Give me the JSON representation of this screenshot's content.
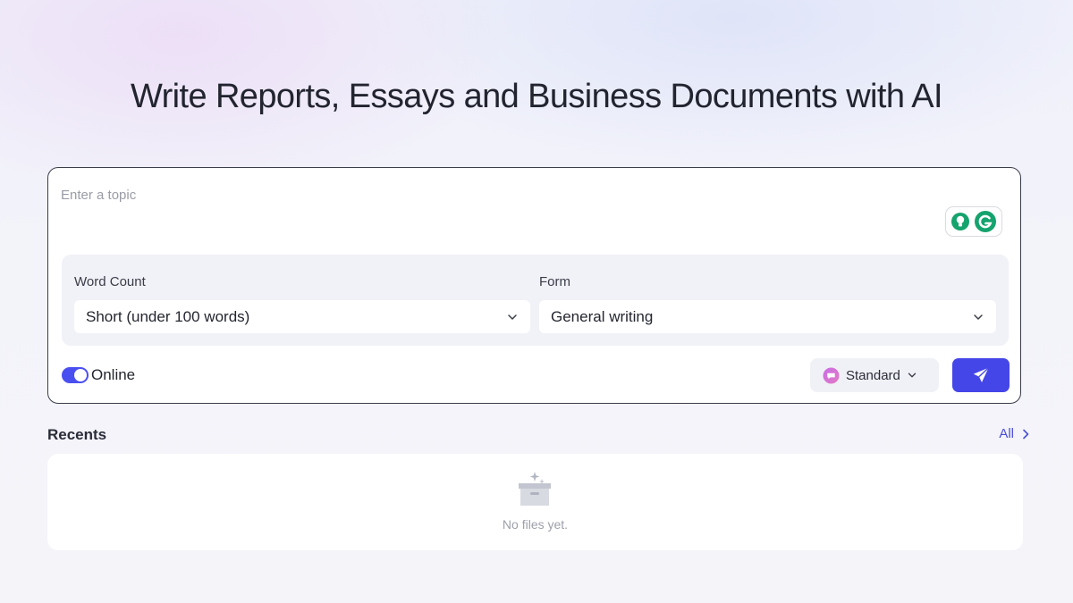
{
  "page": {
    "title": "Write Reports, Essays and Business Documents with AI"
  },
  "composer": {
    "topic_placeholder": "Enter a topic",
    "topic_value": "",
    "word_count": {
      "label": "Word Count",
      "selected": "Short (under 100 words)"
    },
    "form": {
      "label": "Form",
      "selected": "General writing"
    },
    "online": {
      "label": "Online",
      "enabled": true
    },
    "mode": {
      "label": "Standard"
    }
  },
  "recents": {
    "title": "Recents",
    "all_label": "All",
    "empty_text": "No files yet."
  },
  "colors": {
    "accent": "#4546e8",
    "toggle_on": "#4a4ff0",
    "link": "#4b4fd6",
    "grammarly_green": "#15a36e"
  },
  "icons": {
    "extension": [
      "lightbulb-icon",
      "grammarly-icon"
    ],
    "select_chevron": "chevron-down-icon",
    "mode": "chat-bubble-icon",
    "send": "send-icon",
    "all": "chevron-right-icon",
    "empty": "empty-box-icon"
  }
}
